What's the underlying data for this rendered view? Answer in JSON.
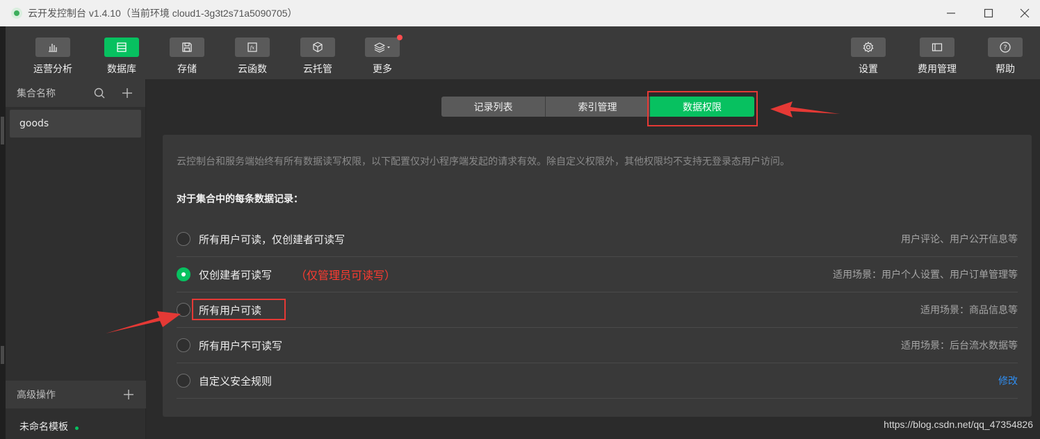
{
  "window": {
    "title": "云开发控制台 v1.4.10（当前环境 cloud1-3g3t2s71a5090705）"
  },
  "toolbar": {
    "left": [
      {
        "label": "运营分析",
        "icon": "bar-chart-icon",
        "active": false
      },
      {
        "label": "数据库",
        "icon": "database-icon",
        "active": true
      },
      {
        "label": "存储",
        "icon": "storage-icon",
        "active": false
      },
      {
        "label": "云函数",
        "icon": "function-icon",
        "active": false
      },
      {
        "label": "云托管",
        "icon": "box-icon",
        "active": false
      },
      {
        "label": "更多",
        "icon": "layers-dropdown-icon",
        "active": false,
        "badge": true
      }
    ],
    "right": [
      {
        "label": "设置",
        "icon": "gear-icon"
      },
      {
        "label": "费用管理",
        "icon": "billing-icon"
      },
      {
        "label": "帮助",
        "icon": "help-icon"
      }
    ]
  },
  "sidebar": {
    "collections_title": "集合名称",
    "collections": [
      "goods"
    ],
    "advanced_title": "高级操作",
    "template_name": "未命名模板"
  },
  "tabs": [
    {
      "label": "记录列表",
      "active": false
    },
    {
      "label": "索引管理",
      "active": false
    },
    {
      "label": "数据权限",
      "active": true
    }
  ],
  "permissions": {
    "notice": "云控制台和服务端始终有所有数据读写权限，以下配置仅对小程序端发起的请求有效。除自定义权限外，其他权限均不支持无登录态用户访问。",
    "heading": "对于集合中的每条数据记录：",
    "options": [
      {
        "label": "所有用户可读，仅创建者可读写",
        "note": "",
        "right": "用户评论、用户公开信息等",
        "checked": false,
        "link": false
      },
      {
        "label": "仅创建者可读写",
        "note": "（仅管理员可读写）",
        "right": "适用场景：用户个人设置、用户订单管理等",
        "checked": true,
        "link": false
      },
      {
        "label": "所有用户可读",
        "note": "",
        "right": "适用场景：商品信息等",
        "checked": false,
        "link": false
      },
      {
        "label": "所有用户不可读写",
        "note": "",
        "right": "适用场景：后台流水数据等",
        "checked": false,
        "link": false
      },
      {
        "label": "自定义安全规则",
        "note": "",
        "right": "修改",
        "checked": false,
        "link": true
      }
    ]
  },
  "watermark": "https://blog.csdn.net/qq_47354826",
  "colors": {
    "accent": "#07c160",
    "annotation": "#e53935",
    "link": "#2f8ef2"
  }
}
